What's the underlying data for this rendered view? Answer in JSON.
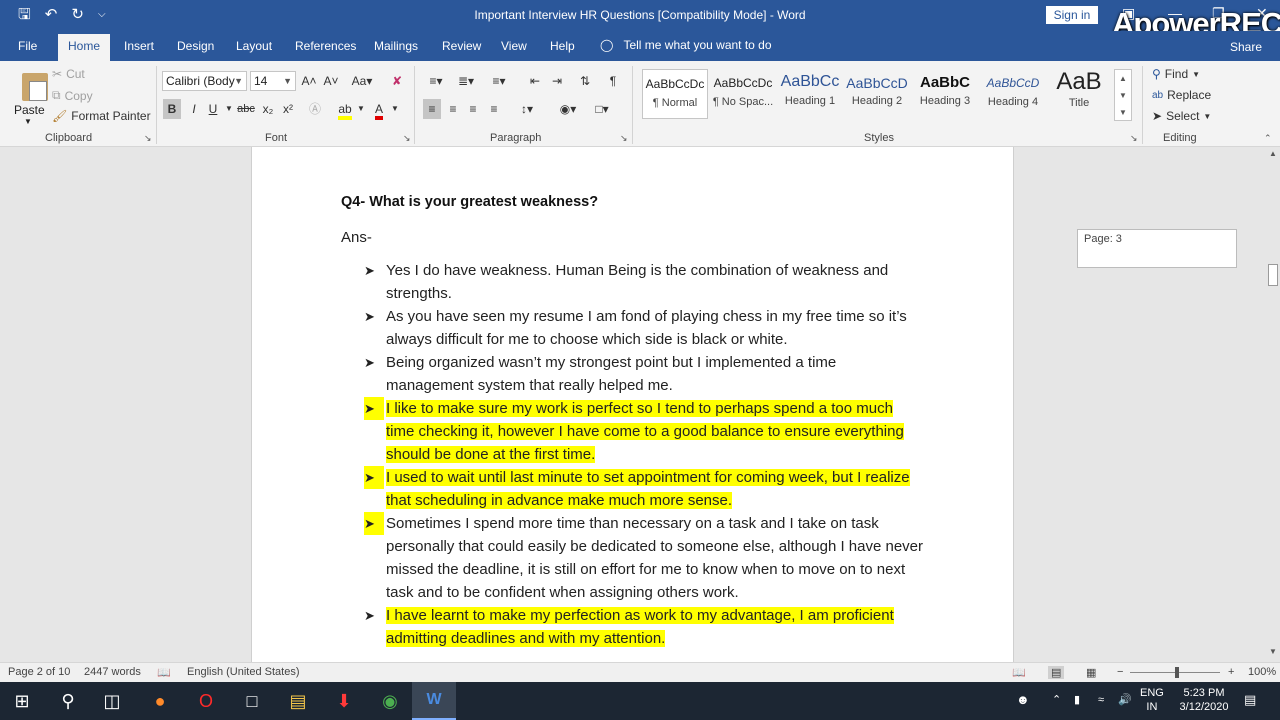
{
  "window": {
    "title": "Important Interview HR Questions [Compatibility Mode]  -  Word",
    "sign_in": "Sign in",
    "watermark": "ApowerREC",
    "share": "Share"
  },
  "menu": {
    "tabs": [
      "File",
      "Home",
      "Insert",
      "Design",
      "Layout",
      "References",
      "Mailings",
      "Review",
      "View",
      "Help"
    ],
    "active_tab": "Home",
    "tell_me": "Tell me what you want to do"
  },
  "ribbon": {
    "clipboard": {
      "paste": "Paste",
      "cut": "Cut",
      "copy": "Copy",
      "format_painter": "Format Painter",
      "label": "Clipboard"
    },
    "font": {
      "name": "Calibri (Body",
      "size": "14",
      "label": "Font",
      "font_color": "#e00000",
      "highlight_color": "#ffff00"
    },
    "paragraph": {
      "label": "Paragraph"
    },
    "styles": {
      "label": "Styles",
      "items": [
        {
          "sample": "AaBbCcDc",
          "name": "¶ Normal"
        },
        {
          "sample": "AaBbCcDc",
          "name": "¶ No Spac..."
        },
        {
          "sample": "AaBbCc",
          "name": "Heading 1"
        },
        {
          "sample": "AaBbCcD",
          "name": "Heading 2"
        },
        {
          "sample": "AaBbC",
          "name": "Heading 3"
        },
        {
          "sample": "AaBbCcD",
          "name": "Heading 4"
        },
        {
          "sample": "AaB",
          "name": "Title"
        }
      ]
    },
    "editing": {
      "find": "Find",
      "replace": "Replace",
      "select": "Select",
      "label": "Editing"
    }
  },
  "document": {
    "question": "Q4- What is your greatest weakness?",
    "answer_label": "Ans-",
    "bullets": [
      {
        "text": "Yes I do have weakness. Human Being is the combination of weakness and strengths.",
        "highlight": false
      },
      {
        "text": "As you have seen my resume I am fond of playing chess in my free time so it’s always difficult for me to choose which side is black or white.",
        "highlight": false
      },
      {
        "text": "Being organized wasn’t my strongest point but I implemented a time management system that really helped me.",
        "highlight": false
      },
      {
        "text": "I like to make sure my work is perfect so I tend to perhaps spend a too much time checking it, however I have come to a good balance to ensure everything should be done at the first time.",
        "highlight": true
      },
      {
        "text": "I used to wait until last minute to set appointment for coming week, but I realize that scheduling in advance make much more sense.",
        "highlight": true
      },
      {
        "text": "Sometimes I spend more time than necessary on a task and I take on task personally that could easily be dedicated to someone else, although I have never missed the deadline, it is still on effort for me to know when to move on to next task and to be confident when assigning others work.",
        "highlight": false
      },
      {
        "text": "I have learnt to make my perfection as work to my advantage, I am proficient admitting deadlines and with my attention.",
        "highlight": true
      }
    ],
    "page_tooltip": "Page: 3"
  },
  "status": {
    "page": "Page 2 of 10",
    "words": "2447 words",
    "language": "English (United States)",
    "zoom": "100%"
  },
  "taskbar": {
    "lang_top": "ENG",
    "lang_bottom": "IN",
    "time": "5:23 PM",
    "date": "3/12/2020"
  },
  "colors": {
    "brand": "#2b579a",
    "highlight": "#ffff00"
  }
}
